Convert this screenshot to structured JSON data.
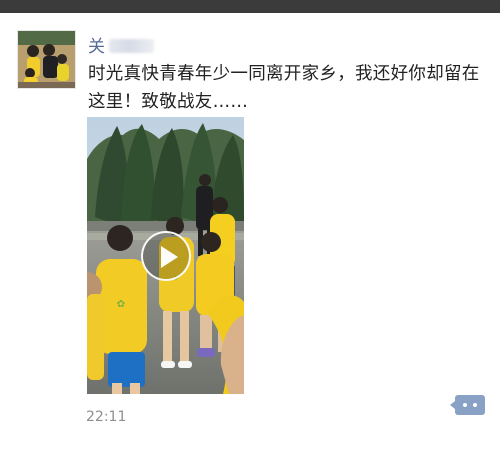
{
  "post": {
    "author_name": "关",
    "text": "时光真快青春年少一同离开家乡，我还好你却留在这里！致敬战友……",
    "timestamp": "22:11"
  },
  "media": {
    "type": "video",
    "play_icon": "play-icon"
  },
  "actions": {
    "comment_icon": "more-dots-icon"
  },
  "colors": {
    "author_blue": "#576b95",
    "text": "#222222",
    "timestamp": "#8f8f8f",
    "comment_button": "#8aa1c6"
  }
}
